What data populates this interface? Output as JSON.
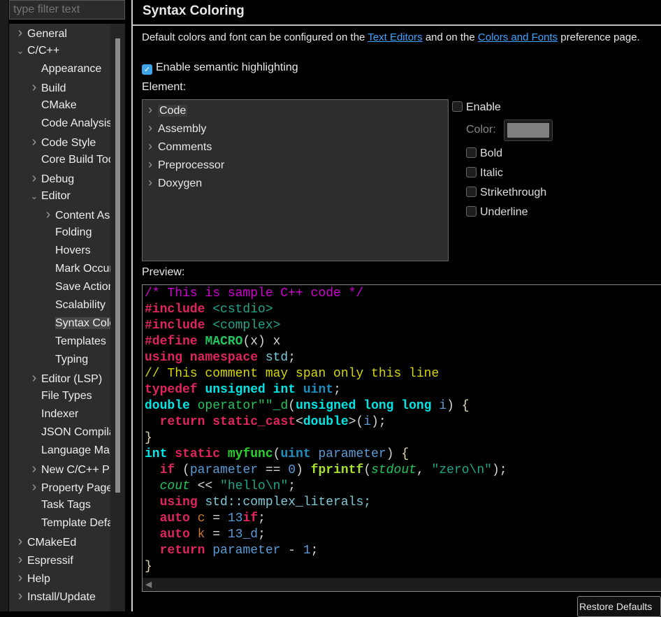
{
  "filter": {
    "placeholder": "type filter text"
  },
  "tree": [
    {
      "label": "General",
      "level": 0,
      "chevron": "right"
    },
    {
      "label": "C/C++",
      "level": 0,
      "chevron": "down"
    },
    {
      "label": "Appearance",
      "level": 1,
      "chevron": ""
    },
    {
      "label": "Build",
      "level": 1,
      "chevron": "right"
    },
    {
      "label": "CMake",
      "level": 1,
      "chevron": ""
    },
    {
      "label": "Code Analysis",
      "level": 1,
      "chevron": ""
    },
    {
      "label": "Code Style",
      "level": 1,
      "chevron": "right"
    },
    {
      "label": "Core Build Toolchains",
      "level": 1,
      "chevron": ""
    },
    {
      "label": "Debug",
      "level": 1,
      "chevron": "right"
    },
    {
      "label": "Editor",
      "level": 1,
      "chevron": "down"
    },
    {
      "label": "Content Assist",
      "level": 2,
      "chevron": "right"
    },
    {
      "label": "Folding",
      "level": 2,
      "chevron": ""
    },
    {
      "label": "Hovers",
      "level": 2,
      "chevron": ""
    },
    {
      "label": "Mark Occurrences",
      "level": 2,
      "chevron": ""
    },
    {
      "label": "Save Actions",
      "level": 2,
      "chevron": ""
    },
    {
      "label": "Scalability",
      "level": 2,
      "chevron": ""
    },
    {
      "label": "Syntax Coloring",
      "level": 2,
      "chevron": "",
      "selected": true
    },
    {
      "label": "Templates",
      "level": 2,
      "chevron": ""
    },
    {
      "label": "Typing",
      "level": 2,
      "chevron": ""
    },
    {
      "label": "Editor (LSP)",
      "level": 1,
      "chevron": "right"
    },
    {
      "label": "File Types",
      "level": 1,
      "chevron": ""
    },
    {
      "label": "Indexer",
      "level": 1,
      "chevron": ""
    },
    {
      "label": "JSON Compilation Database",
      "level": 1,
      "chevron": ""
    },
    {
      "label": "Language Mappings",
      "level": 1,
      "chevron": ""
    },
    {
      "label": "New C/C++ Project Wizard",
      "level": 1,
      "chevron": "right"
    },
    {
      "label": "Property Pages Settings",
      "level": 1,
      "chevron": "right"
    },
    {
      "label": "Task Tags",
      "level": 1,
      "chevron": ""
    },
    {
      "label": "Template Default Values",
      "level": 1,
      "chevron": ""
    },
    {
      "label": "CMakeEd",
      "level": 0,
      "chevron": "right"
    },
    {
      "label": "Espressif",
      "level": 0,
      "chevron": "right"
    },
    {
      "label": "Help",
      "level": 0,
      "chevron": "right"
    },
    {
      "label": "Install/Update",
      "level": 0,
      "chevron": "right"
    }
  ],
  "header": {
    "title": "Syntax Coloring"
  },
  "description": {
    "prefix": "Default colors and font can be configured on the ",
    "link1": "Text Editors",
    "middle": " and on the ",
    "link2": "Colors and Fonts",
    "suffix": " preference page."
  },
  "semantic": {
    "label": "Enable semantic highlighting",
    "checked": true
  },
  "element": {
    "label": "Element:",
    "items": [
      {
        "label": "Code",
        "selected": true
      },
      {
        "label": "Assembly"
      },
      {
        "label": "Comments"
      },
      {
        "label": "Preprocessor"
      },
      {
        "label": "Doxygen"
      }
    ]
  },
  "options": {
    "enable": "Enable",
    "color": "Color:",
    "color_value": "#808080",
    "bold": "Bold",
    "italic": "Italic",
    "strikethrough": "Strikethrough",
    "underline": "Underline"
  },
  "preview": {
    "label": "Preview:",
    "styles": {
      "c": {
        "color": "#d000d0"
      },
      "pp": {
        "color": "#e0245e",
        "bold": true
      },
      "hdr": {
        "color": "#1fa58a"
      },
      "mac": {
        "color": "#22c55e",
        "bold": true
      },
      "t": {
        "color": "#d4d4d4"
      },
      "kw": {
        "color": "#e0245e",
        "bold": true
      },
      "ns": {
        "color": "#7fc8d8"
      },
      "sc": {
        "color": "#d8d800"
      },
      "ty": {
        "color": "#00e5e5",
        "bold": true
      },
      "td": {
        "color": "#1a8fc0",
        "bold": true
      },
      "op": {
        "color": "#22c55e"
      },
      "fn": {
        "color": "#2bd12b",
        "bold": true
      },
      "par": {
        "color": "#5b9bd5"
      },
      "num": {
        "color": "#5b9bd5"
      },
      "ext": {
        "color": "#a6e22e",
        "bold": true
      },
      "gv": {
        "color": "#22c55e",
        "italic": true
      },
      "str": {
        "color": "#1fa58a"
      },
      "loc": {
        "color": "#c8782a"
      },
      "br": {
        "color": "#e8dcb0"
      }
    },
    "lines": [
      [
        [
          "/* This is sample C++ code */",
          "c"
        ]
      ],
      [
        [
          "#include",
          "pp"
        ],
        [
          " <cstdio>",
          "hdr"
        ]
      ],
      [
        [
          "#include",
          "pp"
        ],
        [
          " <complex>",
          "hdr"
        ]
      ],
      [
        [
          "#define",
          "pp"
        ],
        [
          " ",
          "t"
        ],
        [
          "MACRO",
          "mac"
        ],
        [
          "(x) x",
          "t"
        ]
      ],
      [
        [
          "using namespace",
          "kw"
        ],
        [
          " std",
          "ns"
        ],
        [
          ";",
          "t"
        ]
      ],
      [
        [
          "// This comment may span only this line",
          "sc"
        ]
      ],
      [
        [
          "typedef",
          "kw"
        ],
        [
          " ",
          "t"
        ],
        [
          "unsigned int",
          "ty"
        ],
        [
          " ",
          "t"
        ],
        [
          "uint",
          "td"
        ],
        [
          ";",
          "t"
        ]
      ],
      [
        [
          "double",
          "ty"
        ],
        [
          " ",
          "t"
        ],
        [
          "operator\"\"_d",
          "op"
        ],
        [
          "(",
          "t"
        ],
        [
          "unsigned long long",
          "ty"
        ],
        [
          " ",
          "t"
        ],
        [
          "i",
          "par"
        ],
        [
          ") ",
          "t"
        ],
        [
          "{",
          "br"
        ]
      ],
      [
        [
          "  ",
          "t"
        ],
        [
          "return",
          "kw"
        ],
        [
          " ",
          "t"
        ],
        [
          "static_cast",
          "kw"
        ],
        [
          "<",
          "t"
        ],
        [
          "double",
          "ty"
        ],
        [
          ">(",
          "t"
        ],
        [
          "i",
          "par"
        ],
        [
          ");",
          "t"
        ]
      ],
      [
        [
          "}",
          "br"
        ]
      ],
      [
        [
          "int",
          "ty"
        ],
        [
          " ",
          "t"
        ],
        [
          "static",
          "kw"
        ],
        [
          " ",
          "t"
        ],
        [
          "myfunc",
          "fn"
        ],
        [
          "(",
          "t"
        ],
        [
          "uint",
          "td"
        ],
        [
          " ",
          "t"
        ],
        [
          "parameter",
          "par"
        ],
        [
          ") ",
          "t"
        ],
        [
          "{",
          "br"
        ]
      ],
      [
        [
          "  ",
          "t"
        ],
        [
          "if",
          "kw"
        ],
        [
          " (",
          "t"
        ],
        [
          "parameter",
          "par"
        ],
        [
          " == ",
          "t"
        ],
        [
          "0",
          "num"
        ],
        [
          ") ",
          "t"
        ],
        [
          "fprintf",
          "ext"
        ],
        [
          "(",
          "t"
        ],
        [
          "stdout",
          "gv"
        ],
        [
          ", ",
          "t"
        ],
        [
          "\"zero\\n\"",
          "str"
        ],
        [
          ");",
          "t"
        ]
      ],
      [
        [
          "  ",
          "t"
        ],
        [
          "cout",
          "gv"
        ],
        [
          " << ",
          "t"
        ],
        [
          "\"hello\\n\"",
          "str"
        ],
        [
          ";",
          "t"
        ]
      ],
      [
        [
          "  ",
          "t"
        ],
        [
          "using",
          "kw"
        ],
        [
          " std::complex_literals;",
          "ns"
        ]
      ],
      [
        [
          "  ",
          "t"
        ],
        [
          "auto",
          "kw"
        ],
        [
          " ",
          "t"
        ],
        [
          "c",
          "loc"
        ],
        [
          " = ",
          "t"
        ],
        [
          "13",
          "num"
        ],
        [
          "if",
          "kw"
        ],
        [
          ";",
          "t"
        ]
      ],
      [
        [
          "  ",
          "t"
        ],
        [
          "auto",
          "kw"
        ],
        [
          " ",
          "t"
        ],
        [
          "k",
          "loc"
        ],
        [
          " = ",
          "t"
        ],
        [
          "13_d",
          "num"
        ],
        [
          ";",
          "t"
        ]
      ],
      [
        [
          "  ",
          "t"
        ],
        [
          "return",
          "kw"
        ],
        [
          " ",
          "t"
        ],
        [
          "parameter",
          "par"
        ],
        [
          " - ",
          "t"
        ],
        [
          "1",
          "num"
        ],
        [
          ";",
          "t"
        ]
      ],
      [
        [
          "}",
          "br"
        ]
      ]
    ]
  },
  "buttons": {
    "restore": "Restore Defaults"
  }
}
